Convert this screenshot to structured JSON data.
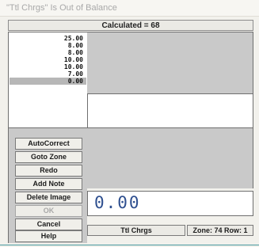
{
  "window": {
    "title": "\"Ttl Chrgs\" Is Out of Balance"
  },
  "calculated_label": "Calculated = 68",
  "value_list": {
    "items": [
      "25.00",
      "8.00",
      "8.00",
      "10.00",
      "10.00",
      "7.00",
      "0.00"
    ],
    "selected_index": 6
  },
  "buttons": {
    "autocorrect": "AutoCorrect",
    "goto_zone": "Goto Zone",
    "redo": "Redo",
    "add_note": "Add Note",
    "delete_image": "Delete Image",
    "ok": "OK",
    "cancel": "Cancel",
    "help": "Help"
  },
  "current_value": "0.00",
  "field_name": "Ttl Chrgs",
  "zone_row": "Zone: 74 Row: 1"
}
